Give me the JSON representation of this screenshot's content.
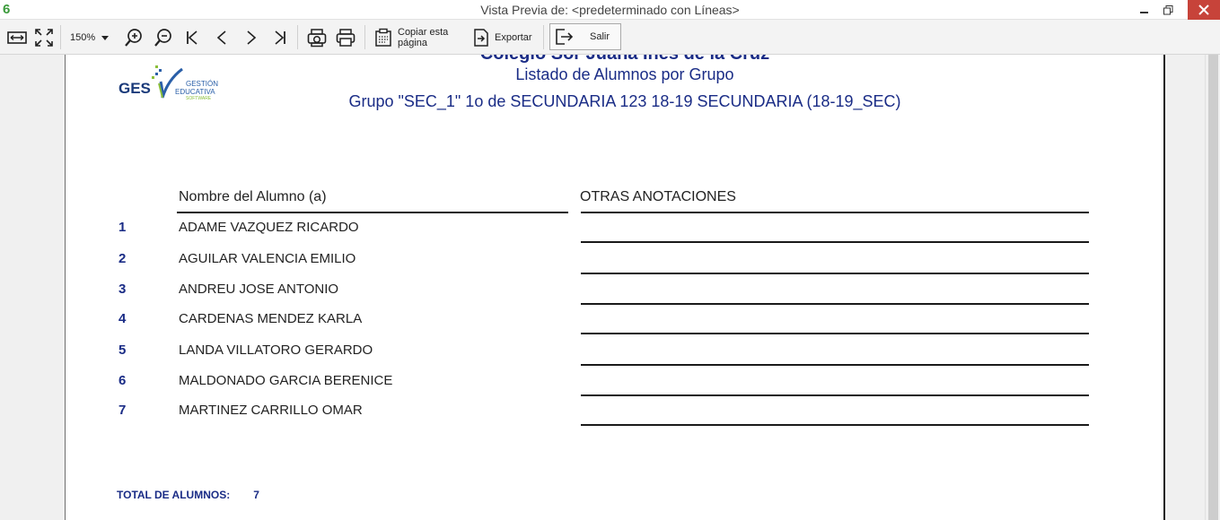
{
  "window": {
    "title": "Vista Previa de: <predeterminado con Líneas>",
    "app_icon": "6"
  },
  "toolbar": {
    "zoom_value": "150%",
    "copy_label_line1": "Copiar esta",
    "copy_label_line2": "página",
    "export_label": "Exportar",
    "exit_label": "Salir",
    "icons": [
      "fit-width-icon",
      "fit-page-icon",
      "zoom-in-icon",
      "zoom-out-icon",
      "first-page-icon",
      "prev-page-icon",
      "next-page-icon",
      "last-page-icon",
      "print-setup-icon",
      "print-icon",
      "copy-page-icon",
      "export-icon",
      "exit-icon"
    ]
  },
  "report": {
    "logo": {
      "text": "GES",
      "line1": "GESTIÓN",
      "line2": "EDUCATIVA",
      "line3": "SOFTWARE"
    },
    "school_name": "Colegio Sor Juana Inés de la Cruz",
    "title": "Listado de Alumnos por Grupo",
    "subtitle": "Grupo \"SEC_1\" 1o de SECUNDARIA 123 18-19 SECUNDARIA (18-19_SEC)",
    "col_name_header": "Nombre del Alumno (a)",
    "col_notes_header": "OTRAS ANOTACIONES",
    "students": [
      {
        "num": "1",
        "name": "ADAME VAZQUEZ  RICARDO"
      },
      {
        "num": "2",
        "name": "AGUILAR VALENCIA EMILIO"
      },
      {
        "num": "3",
        "name": "ANDREU  JOSE ANTONIO"
      },
      {
        "num": "4",
        "name": "CARDENAS MENDEZ KARLA"
      },
      {
        "num": "5",
        "name": "LANDA VILLATORO GERARDO"
      },
      {
        "num": "6",
        "name": "MALDONADO GARCIA BERENICE"
      },
      {
        "num": "7",
        "name": "MARTINEZ CARRILLO OMAR"
      }
    ],
    "total_label": "TOTAL DE ALUMNOS:",
    "total_value": "7"
  },
  "colors": {
    "report_blue": "#1a2c86",
    "close_red": "#c7433a",
    "logo_blue": "#2a5fa8",
    "logo_green": "#8bbf3a"
  }
}
